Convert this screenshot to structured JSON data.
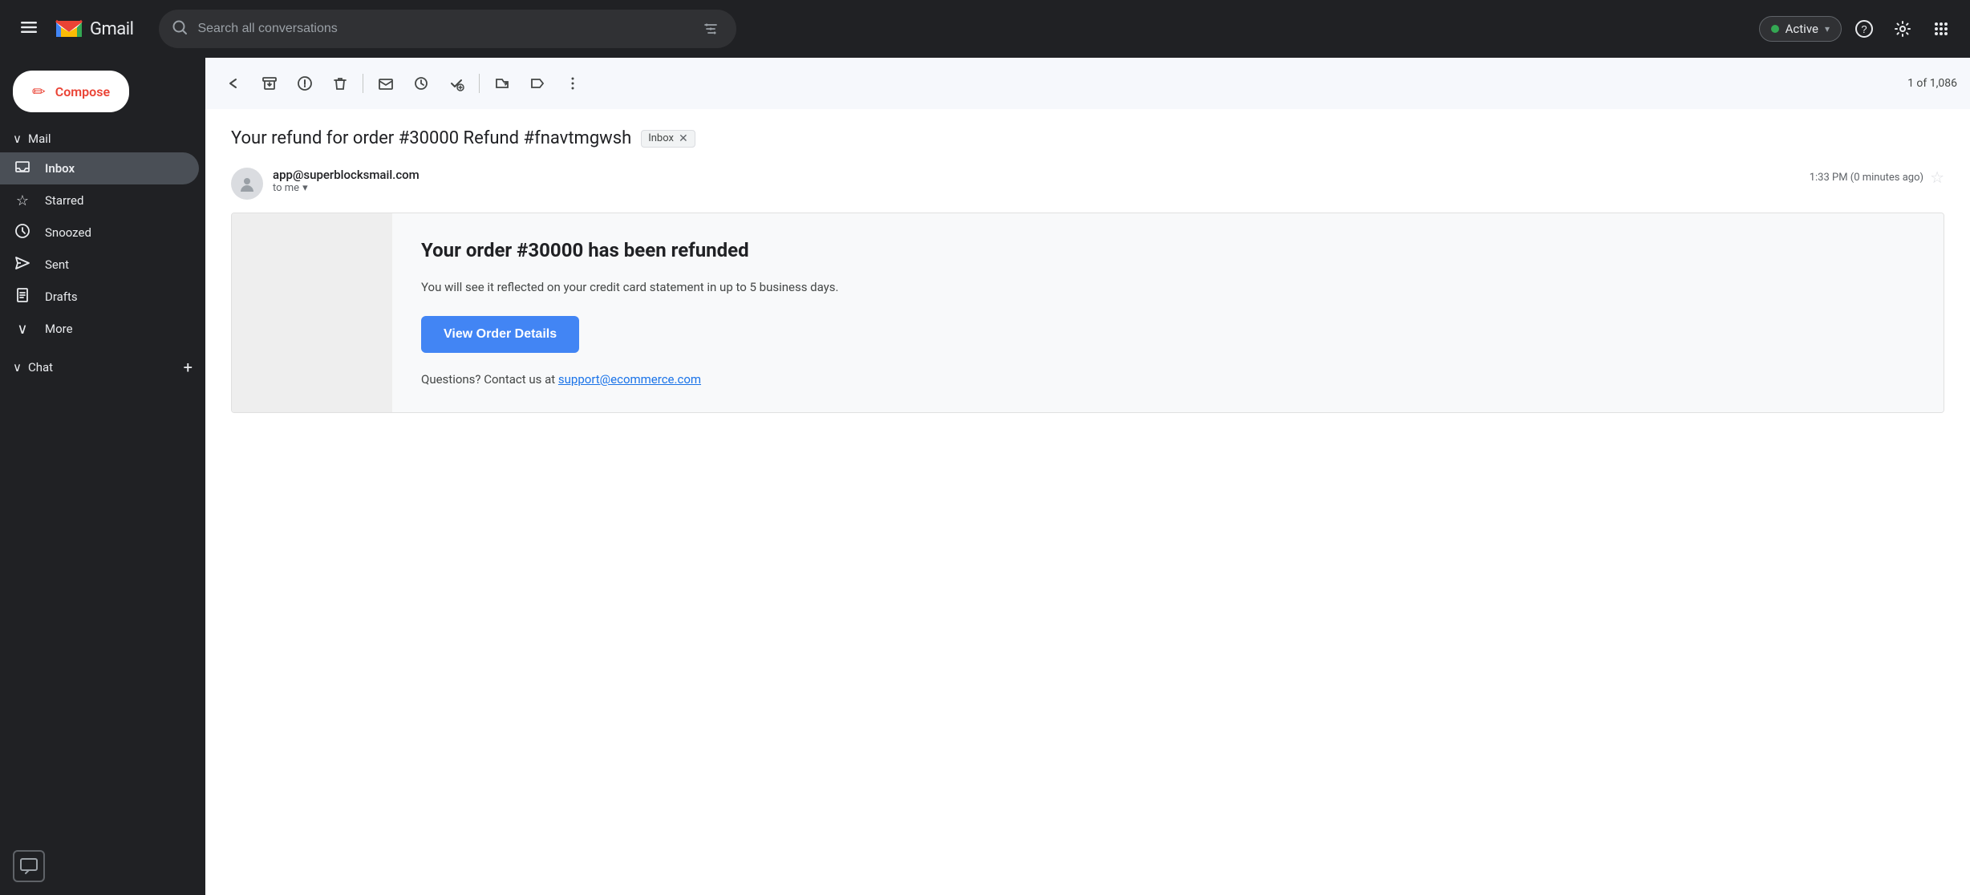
{
  "header": {
    "menu_label": "☰",
    "gmail_text": "Gmail",
    "search_placeholder": "Search all conversations",
    "active_label": "Active",
    "help_icon": "?",
    "settings_icon": "⚙",
    "grid_icon": "⋮⋮⋮",
    "filter_icon": "≡"
  },
  "sidebar": {
    "mail_label": "Mail",
    "compose_label": "Compose",
    "items": [
      {
        "id": "inbox",
        "label": "Inbox",
        "icon": "⬜",
        "active": true
      },
      {
        "id": "starred",
        "label": "Starred",
        "icon": "☆"
      },
      {
        "id": "snoozed",
        "label": "Snoozed",
        "icon": "🕐"
      },
      {
        "id": "sent",
        "label": "Sent",
        "icon": "▷"
      },
      {
        "id": "drafts",
        "label": "Drafts",
        "icon": "📄"
      },
      {
        "id": "more",
        "label": "More",
        "icon": "∨"
      }
    ],
    "chat_label": "Chat",
    "chat_plus": "+"
  },
  "email": {
    "subject": "Your refund for order #30000 Refund #fnavtmgwsh",
    "inbox_badge": "Inbox",
    "from": "app@superblocksmail.com",
    "to_label": "to me",
    "time": "1:33 PM (0 minutes ago)",
    "pagination": "1 of 1,086",
    "body": {
      "title": "Your order #30000 has been refunded",
      "description": "You will see it reflected on your credit card statement in up to 5 business days.",
      "cta_label": "View Order Details",
      "support_text": "Questions? Contact us at ",
      "support_link": "support@ecommerce.com"
    }
  },
  "toolbar": {
    "back": "←",
    "archive": "⬇",
    "spam": "⊘",
    "delete": "🗑",
    "mark_unread": "✉",
    "snooze": "🕐",
    "task": "✓",
    "move": "→",
    "label": "⬛",
    "more": "⋮"
  },
  "icons": {
    "search": "🔍",
    "menu": "☰",
    "compose_pencil": "✏",
    "person": "👤",
    "chevron_down": "▾",
    "chat_bubble": "💬"
  }
}
